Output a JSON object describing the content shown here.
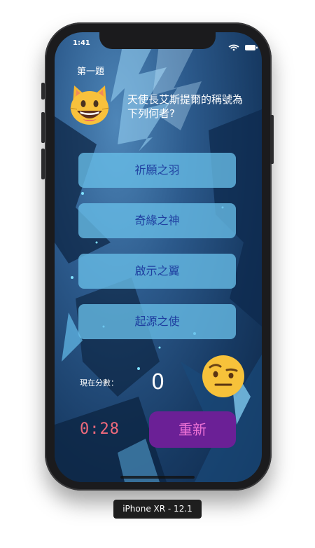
{
  "status_bar": {
    "time": "1:41"
  },
  "quiz": {
    "question_label": "第一題",
    "question_text": "天使長艾斯提爾的稱號為下列何者?",
    "answers": [
      "祈願之羽",
      "奇緣之神",
      "啟示之翼",
      "起源之使"
    ]
  },
  "score": {
    "label": "現在分數：",
    "value": "0"
  },
  "timer": {
    "text": "0:28"
  },
  "reset_button": {
    "label": "重新"
  },
  "device_label": "iPhone XR - 12.1",
  "icons": {
    "question_avatar": "smiling-cat-emoji",
    "reaction": "face-with-raised-eyebrow-emoji",
    "status": [
      "wifi-icon",
      "battery-icon"
    ]
  },
  "colors": {
    "answer_bg": "#68bee8",
    "answer_text": "#1f3fa0",
    "reset_bg": "#6b2096",
    "reset_text": "#ee72d6",
    "timer_text": "#f06a7c"
  }
}
